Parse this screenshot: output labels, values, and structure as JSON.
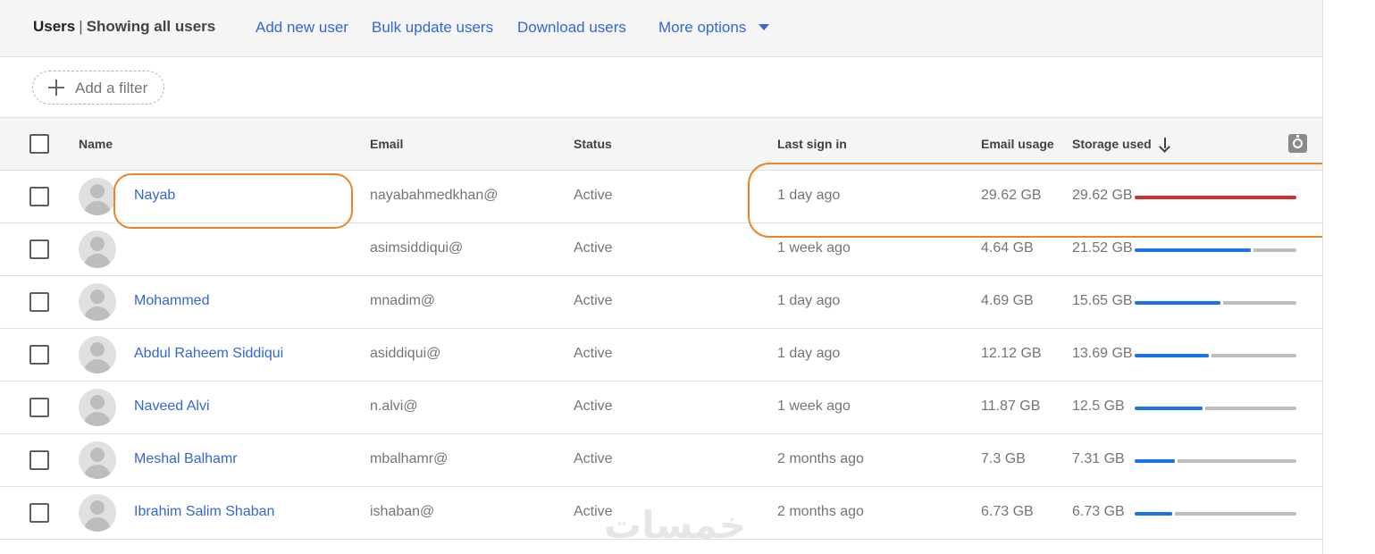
{
  "toolbar": {
    "title": "Users",
    "separator": "|",
    "subtitle": "Showing all users",
    "add_user": "Add new user",
    "bulk_update": "Bulk update users",
    "download": "Download users",
    "more_options": "More options"
  },
  "filter": {
    "add_filter": "Add a filter"
  },
  "columns": {
    "name": "Name",
    "email": "Email",
    "status": "Status",
    "last_sign_in": "Last sign in",
    "email_usage": "Email usage",
    "storage_used": "Storage used"
  },
  "rows": [
    {
      "name": "Nayab",
      "email": "nayabahmedkhan@",
      "status": "Active",
      "last_sign_in": "1 day ago",
      "email_usage": "29.62 GB",
      "storage_used": "29.62 GB",
      "storage_fraction": 1.0
    },
    {
      "name": "",
      "email": "asimsiddiqui@",
      "status": "Active",
      "last_sign_in": "1 week ago",
      "email_usage": "4.64 GB",
      "storage_used": "21.52 GB",
      "storage_fraction": 0.72
    },
    {
      "name": "Mohammed",
      "email": "mnadim@",
      "status": "Active",
      "last_sign_in": "1 day ago",
      "email_usage": "4.69 GB",
      "storage_used": "15.65 GB",
      "storage_fraction": 0.53
    },
    {
      "name": "Abdul Raheem Siddiqui",
      "email": "asiddiqui@",
      "status": "Active",
      "last_sign_in": "1 day ago",
      "email_usage": "12.12 GB",
      "storage_used": "13.69 GB",
      "storage_fraction": 0.46
    },
    {
      "name": "Naveed Alvi",
      "email": "n.alvi@",
      "status": "Active",
      "last_sign_in": "1 week ago",
      "email_usage": "11.87 GB",
      "storage_used": "12.5 GB",
      "storage_fraction": 0.42
    },
    {
      "name": "Meshal Balhamr",
      "email": "mbalhamr@",
      "status": "Active",
      "last_sign_in": "2 months ago",
      "email_usage": "7.3 GB",
      "storage_used": "7.31 GB",
      "storage_fraction": 0.25
    },
    {
      "name": "Ibrahim Salim Shaban",
      "email": "ishaban@",
      "status": "Active",
      "last_sign_in": "2 months ago",
      "email_usage": "6.73 GB",
      "storage_used": "6.73 GB",
      "storage_fraction": 0.23
    }
  ],
  "watermark": "خمسات",
  "colors": {
    "link": "#3367d6",
    "bar_fill": "#1a73e8",
    "bar_full": "#d32f2f",
    "highlight": "#e8842a"
  }
}
